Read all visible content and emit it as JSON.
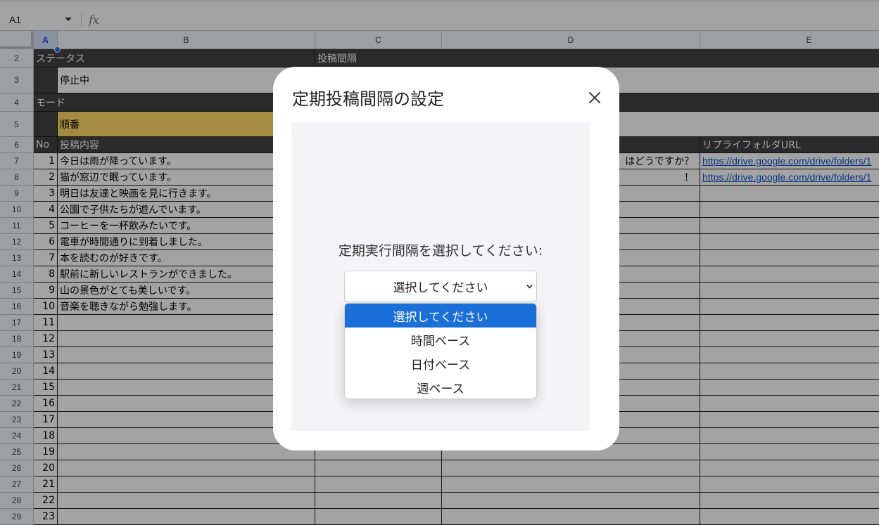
{
  "formula_bar": {
    "cell_ref": "A1",
    "fx": "fx"
  },
  "columns": [
    "A",
    "B",
    "C",
    "D",
    "E"
  ],
  "labels": {
    "status_header": "ステータス",
    "interval_header": "投稿間隔",
    "status_value": "停止中",
    "mode_header": "モード",
    "mode_value": "順番",
    "no_header": "No",
    "content_header": "投稿内容",
    "reply_folder_header": "リプライフォルダURL"
  },
  "row_numbers": [
    "2",
    "3",
    "4",
    "5",
    "6",
    "7",
    "8",
    "9",
    "10",
    "11",
    "12",
    "13",
    "14",
    "15",
    "16",
    "17",
    "18",
    "19",
    "20",
    "21",
    "22",
    "23",
    "24",
    "25",
    "26",
    "27",
    "28",
    "29"
  ],
  "posts": [
    {
      "no": "1",
      "content": "今日は雨が降っています。"
    },
    {
      "no": "2",
      "content": "猫が窓辺で眠っています。"
    },
    {
      "no": "3",
      "content": "明日は友達と映画を見に行きます。"
    },
    {
      "no": "4",
      "content": "公園で子供たちが遊んでいます。"
    },
    {
      "no": "5",
      "content": "コーヒーを一杯飲みたいです。"
    },
    {
      "no": "6",
      "content": "電車が時間通りに到着しました。"
    },
    {
      "no": "7",
      "content": "本を読むのが好きです。"
    },
    {
      "no": "8",
      "content": "駅前に新しいレストランができました。"
    },
    {
      "no": "9",
      "content": "山の景色がとても美しいです。"
    },
    {
      "no": "10",
      "content": "音楽を聴きながら勉強します。"
    },
    {
      "no": "11",
      "content": ""
    },
    {
      "no": "12",
      "content": ""
    },
    {
      "no": "13",
      "content": ""
    },
    {
      "no": "14",
      "content": ""
    },
    {
      "no": "15",
      "content": ""
    },
    {
      "no": "16",
      "content": ""
    },
    {
      "no": "17",
      "content": ""
    },
    {
      "no": "18",
      "content": ""
    },
    {
      "no": "19",
      "content": ""
    },
    {
      "no": "20",
      "content": ""
    },
    {
      "no": "21",
      "content": ""
    },
    {
      "no": "22",
      "content": ""
    },
    {
      "no": "23",
      "content": ""
    }
  ],
  "column_d_texts": [
    "はどうですか？",
    "！"
  ],
  "reply_urls": [
    "https://drive.google.com/drive/folders/1",
    "https://drive.google.com/drive/folders/1"
  ],
  "modal": {
    "title": "定期投稿間隔の設定",
    "prompt": "定期実行間隔を選択してください:",
    "select_value": "選択してください",
    "options": [
      "選択してください",
      "時間ベース",
      "日付ベース",
      "週ベース"
    ]
  },
  "colors": {
    "header_dark": "#434343",
    "mode_highlight": "#ffd966",
    "active_option": "#1a6fd9",
    "link": "#1155cc"
  }
}
